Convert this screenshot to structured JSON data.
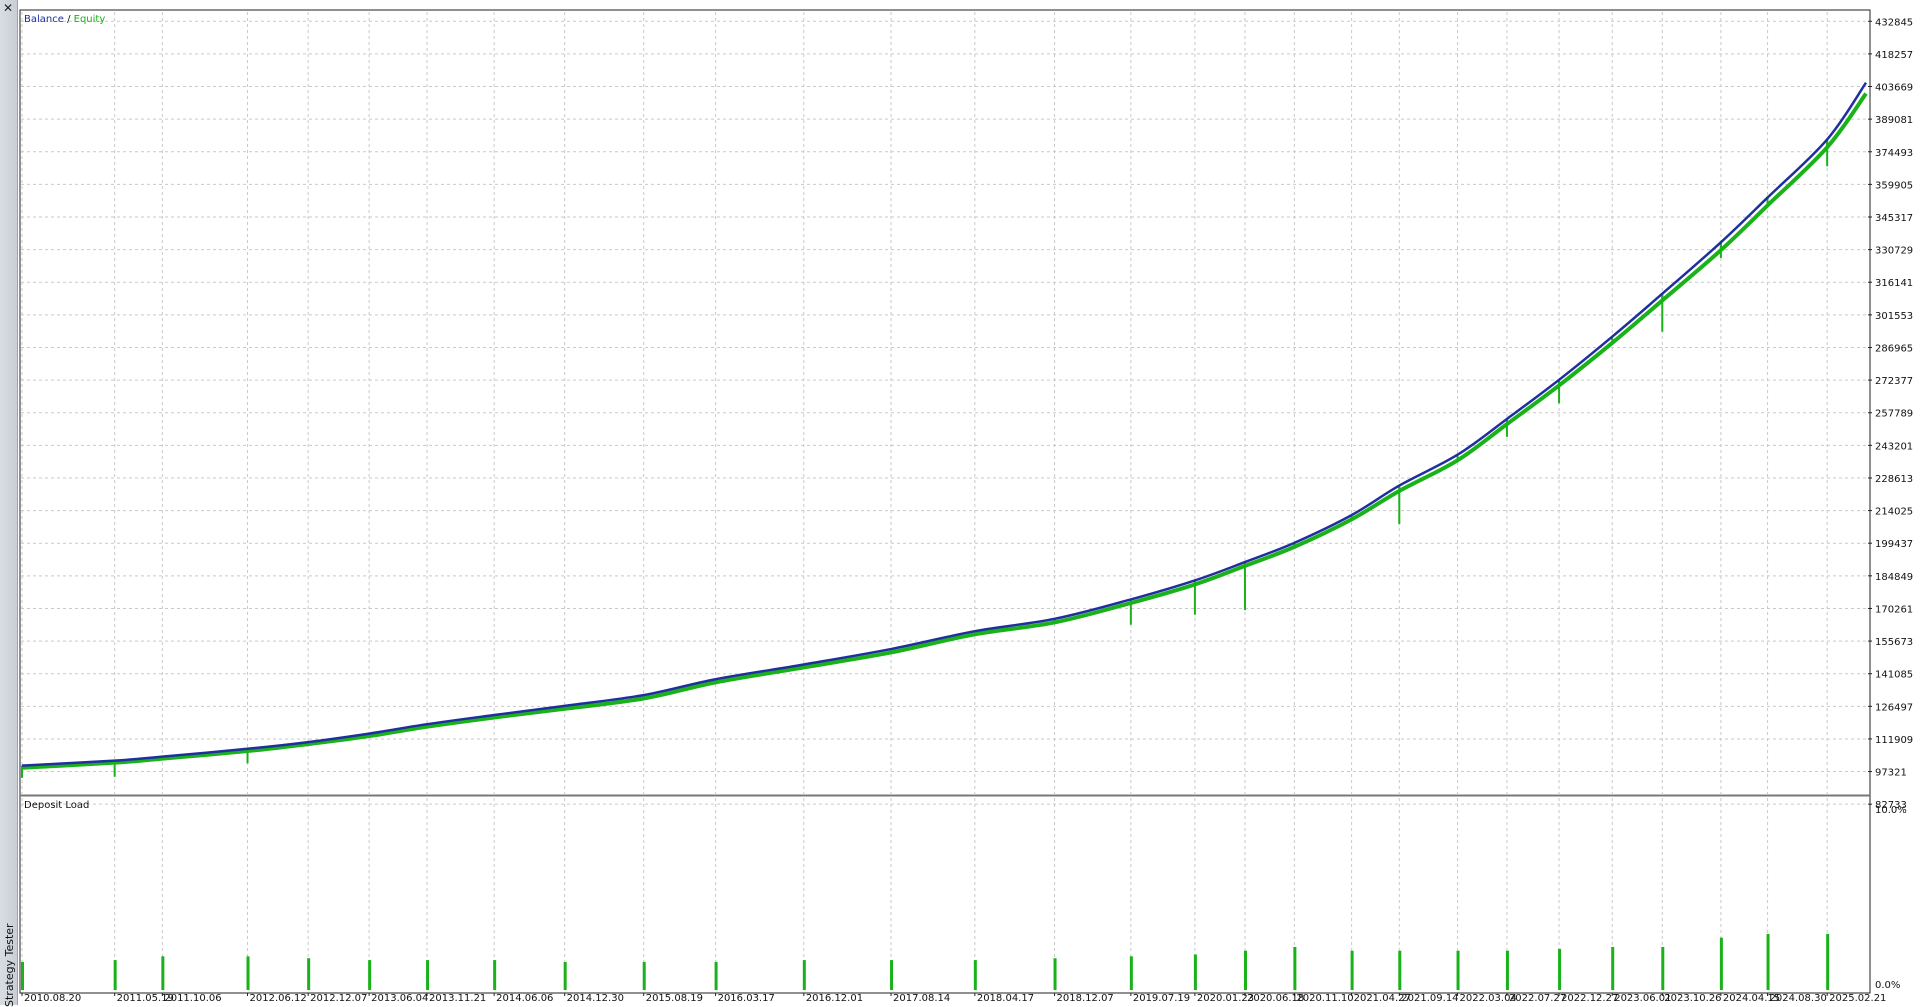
{
  "window": {
    "side_label": "Strategy Tester",
    "close_glyph": "✕"
  },
  "colors": {
    "balance": "#1f2f9e",
    "equity": "#19b219",
    "load": "#19b219",
    "grid": "#c9c9c9"
  },
  "chart_data": [
    {
      "type": "line",
      "legend": [
        "Balance",
        "Equity"
      ],
      "legend_placement": "top-left",
      "x": [
        "2010.08.20",
        "2011.05.19",
        "2011.10.06",
        "2012.06.12",
        "2012.12.07",
        "2013.06.04",
        "2013.11.21",
        "2014.06.06",
        "2014.12.30",
        "2015.08.19",
        "2016.03.17",
        "2016.12.01",
        "2017.08.14",
        "2018.04.17",
        "2018.12.07",
        "2019.07.19",
        "2020.01.23",
        "2020.06.18",
        "2020.11.10",
        "2021.04.27",
        "2021.09.14",
        "2022.03.04",
        "2022.07.27",
        "2022.12.27",
        "2023.06.01",
        "2023.10.26",
        "2024.04.15",
        "2024.08.30",
        "2025.02.21"
      ],
      "series": [
        {
          "name": "Balance",
          "values": [
            100000,
            102200,
            104000,
            107500,
            110500,
            114300,
            118500,
            122600,
            126700,
            131500,
            138600,
            145200,
            152100,
            160100,
            165600,
            174300,
            182800,
            191000,
            199600,
            212000,
            225200,
            239000,
            255000,
            272500,
            291800,
            311000,
            334000,
            354000,
            380000
          ]
        },
        {
          "name": "Equity",
          "values": [
            99000,
            101300,
            103100,
            106500,
            109600,
            113200,
            117400,
            121500,
            125400,
            130000,
            137200,
            143900,
            150600,
            158700,
            164000,
            172700,
            181000,
            189300,
            197800,
            210100,
            222800,
            236500,
            252700,
            270000,
            289000,
            308000,
            330500,
            350500,
            376500
          ]
        }
      ],
      "equity_spikes": [
        {
          "x": "2010.08.20",
          "low": 94500
        },
        {
          "x": "2011.05.19",
          "low": 95000
        },
        {
          "x": "2012.06.12",
          "low": 101000
        },
        {
          "x": "2019.07.19",
          "low": 163000
        },
        {
          "x": "2020.01.23",
          "low": 167500
        },
        {
          "x": "2020.06.18",
          "low": 169500
        },
        {
          "x": "2021.09.14",
          "low": 208000
        },
        {
          "x": "2022.07.27",
          "low": 247000
        },
        {
          "x": "2022.12.27",
          "low": 262000
        },
        {
          "x": "2023.10.26",
          "low": 294000
        },
        {
          "x": "2024.04.15",
          "low": 327000
        },
        {
          "x": "2025.02.21",
          "low": 368000
        }
      ],
      "final_point": {
        "x": "2025.06.15",
        "balance": 405400,
        "equity": 400500
      },
      "ylim": [
        87733,
        436992
      ],
      "yticks": [
        "432845",
        "418257",
        "403669",
        "389081",
        "374493",
        "359905",
        "345317",
        "330729",
        "316141",
        "301553",
        "286965",
        "272377",
        "257789",
        "243201",
        "228613",
        "214025",
        "199437",
        "184849",
        "170261",
        "155673",
        "141085",
        "126497",
        "111909",
        "97321",
        "82733"
      ],
      "grid": true
    },
    {
      "type": "bar",
      "title": "Deposit Load",
      "ylabel_ticks": [
        "10.0%",
        "0.0%"
      ],
      "ylim": [
        0,
        10
      ],
      "x": [
        "2010.08.20",
        "2011.05.19",
        "2011.10.06",
        "2012.06.12",
        "2012.12.07",
        "2013.06.04",
        "2013.11.21",
        "2014.06.06",
        "2014.12.30",
        "2015.08.19",
        "2016.03.17",
        "2016.12.01",
        "2017.08.14",
        "2018.04.17",
        "2018.12.07",
        "2019.07.19",
        "2020.01.23",
        "2020.06.18",
        "2020.11.10",
        "2021.04.27",
        "2021.09.14",
        "2022.03.04",
        "2022.07.27",
        "2022.12.27",
        "2023.06.01",
        "2023.10.26",
        "2024.04.15",
        "2024.08.30",
        "2025.02.21"
      ],
      "values": [
        1.5,
        1.6,
        1.8,
        1.8,
        1.7,
        1.6,
        1.6,
        1.6,
        1.5,
        1.5,
        1.5,
        1.6,
        1.6,
        1.6,
        1.7,
        1.8,
        1.9,
        2.1,
        2.3,
        2.1,
        2.1,
        2.1,
        2.1,
        2.2,
        2.3,
        2.3,
        2.8,
        3.0,
        3.0
      ],
      "grid": true
    }
  ]
}
